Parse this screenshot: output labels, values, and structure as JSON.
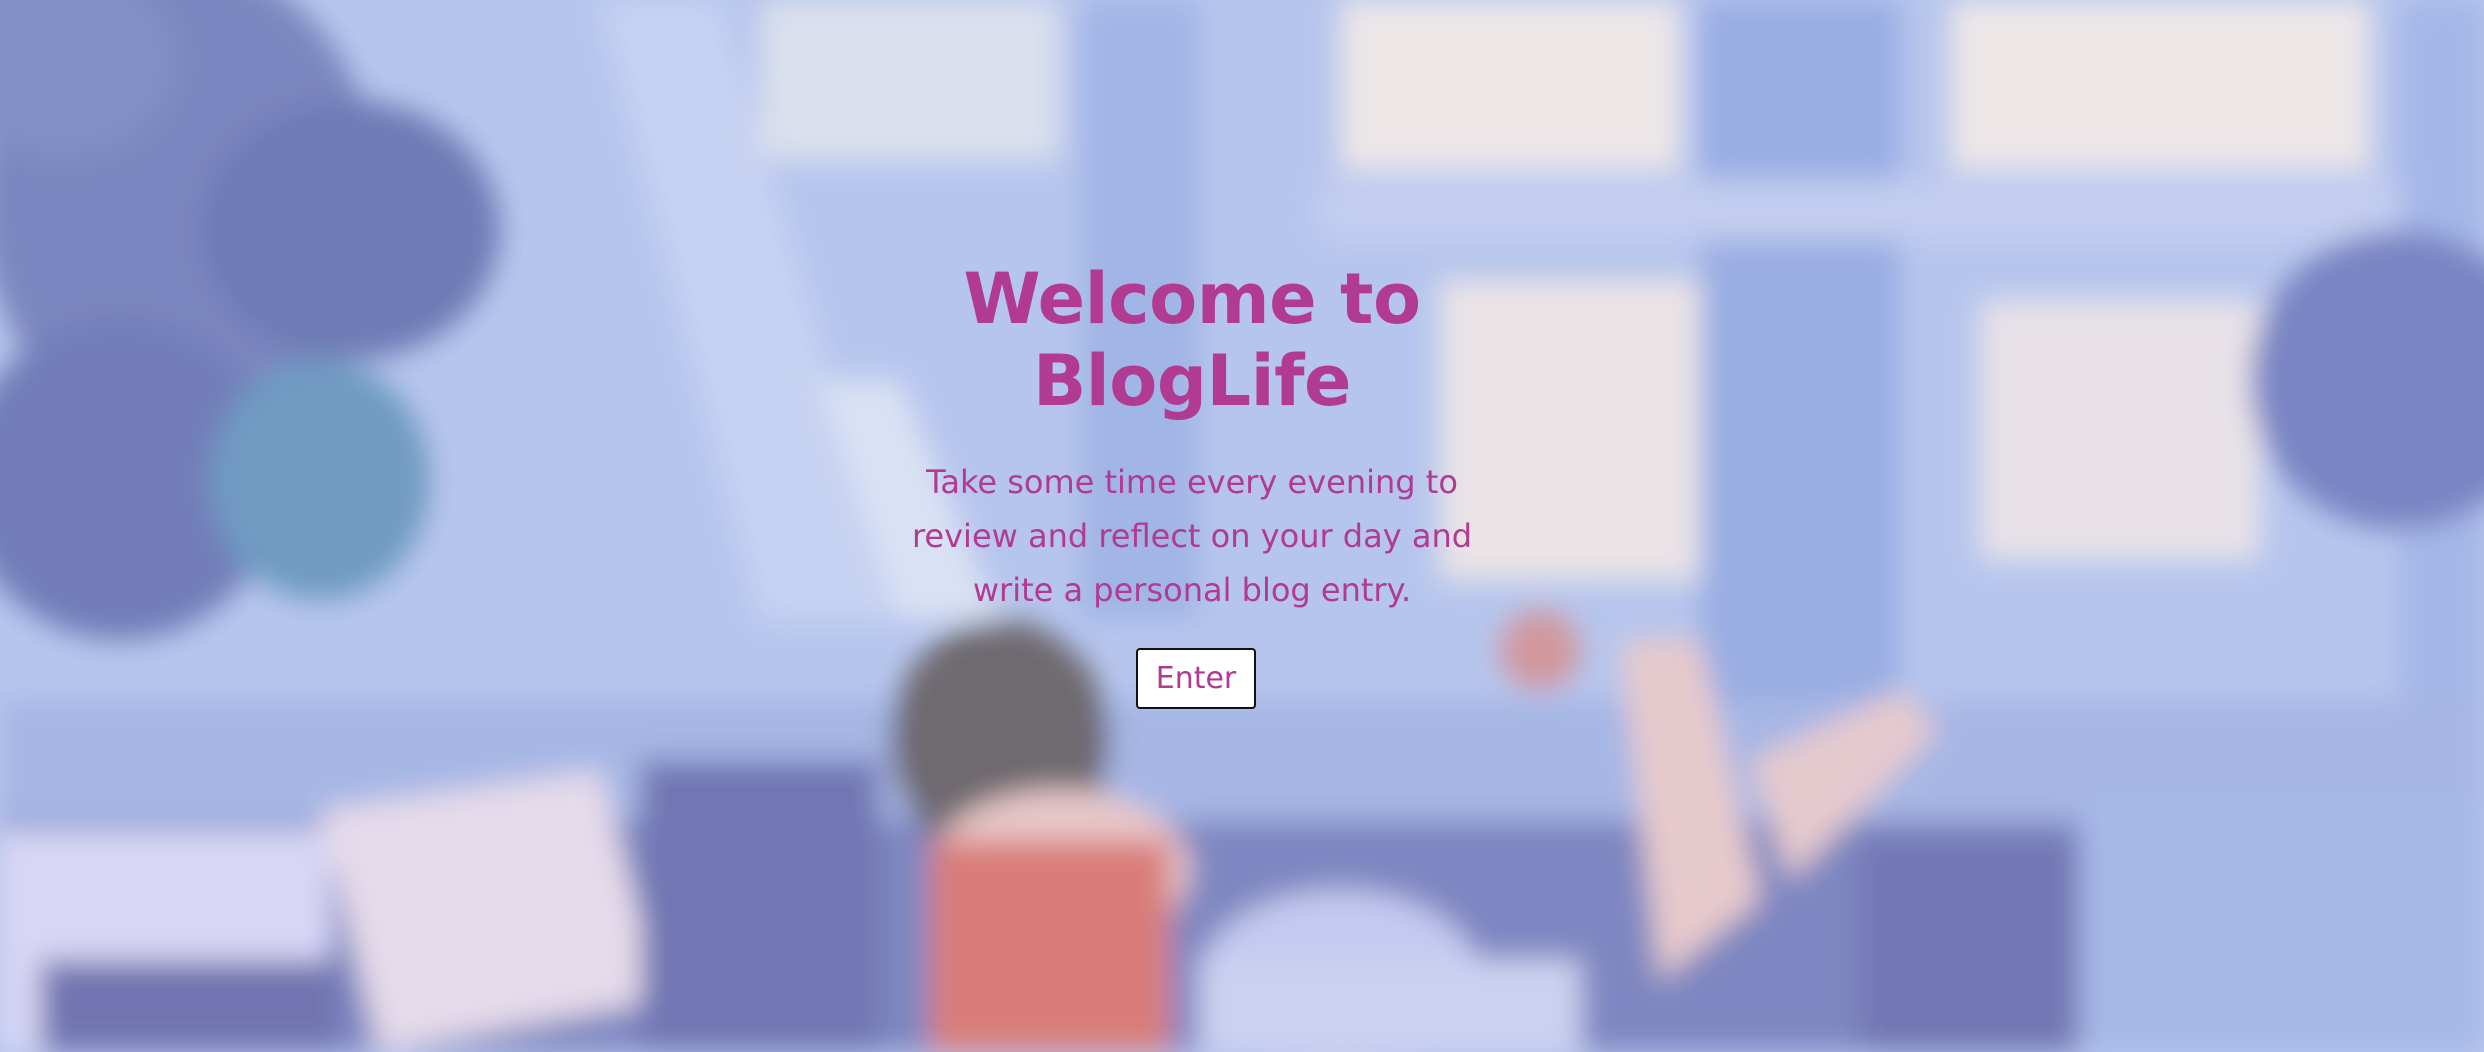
{
  "hero": {
    "title": "Welcome to BlogLife",
    "subtitle": "Take some time every evening to review and reflect on your day and write a personal blog entry.",
    "button_label": "Enter"
  },
  "colors": {
    "accent": "#b13a93",
    "button_background": "#ffffff",
    "button_border": "#111111",
    "background_base": "#b3c3ec"
  },
  "background_image": "blurred-illustration-girl-at-desk-by-window"
}
